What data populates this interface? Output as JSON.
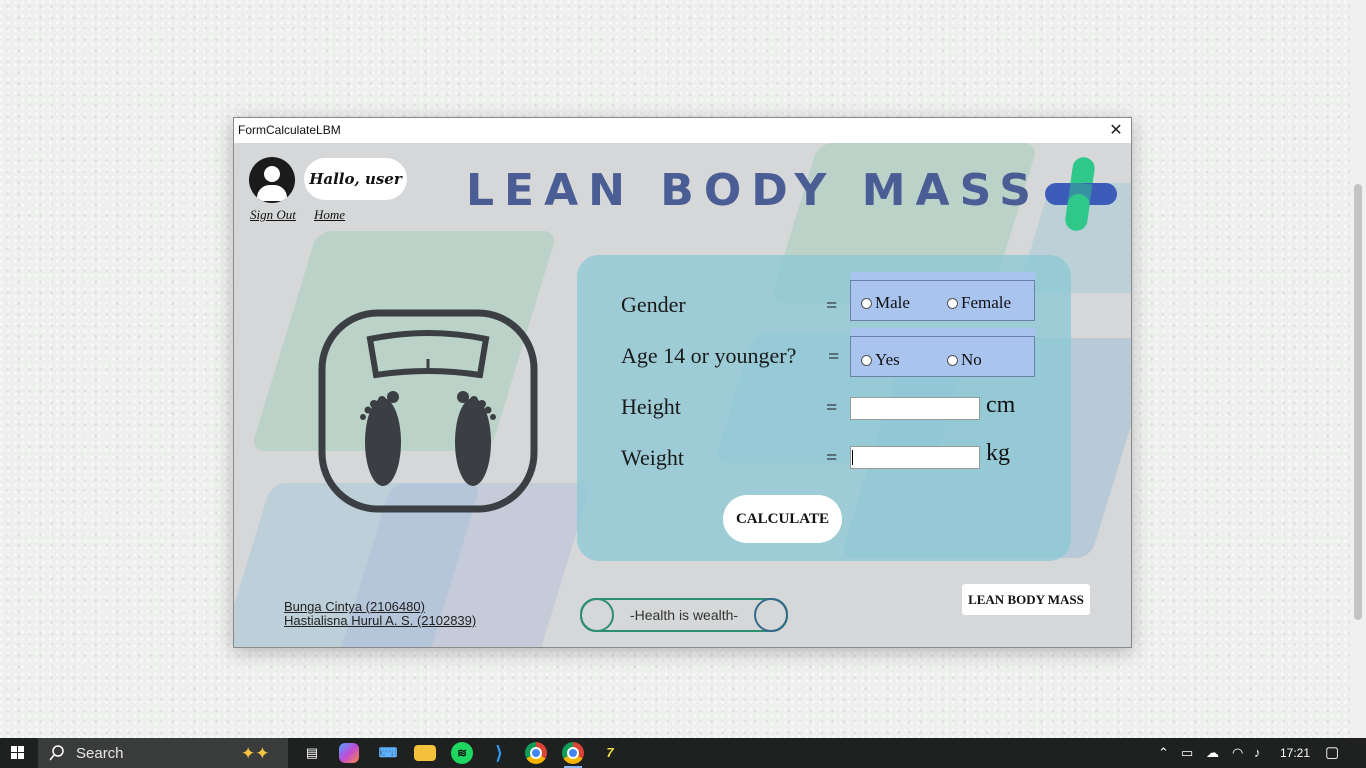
{
  "window": {
    "title": "FormCalculateLBM",
    "close_glyph": "✕"
  },
  "header": {
    "greeting": "Hallo, user",
    "sign_out": "Sign Out",
    "home": "Home",
    "title": "LEAN BODY MASS"
  },
  "form": {
    "gender_label": "Gender",
    "gender_options": [
      "Male",
      "Female"
    ],
    "age_label": "Age 14 or younger?",
    "age_options": [
      "Yes",
      "No"
    ],
    "height_label": "Height",
    "height_value": "",
    "height_unit": "cm",
    "weight_label": "Weight",
    "weight_value": "",
    "weight_unit": "kg",
    "equals": "=",
    "calculate": "CALCULATE"
  },
  "footer": {
    "credit_1": "Bunga Cintya (2106480)",
    "credit_2": "Hastialisna Hurul A. S. (2102839)",
    "motto": "-Health is wealth-",
    "lbm_button": "LEAN BODY MASS"
  },
  "taskbar": {
    "search_placeholder": "Search",
    "time": "17:21",
    "apps": [
      "task-view-icon",
      "copilot-icon",
      "keyboard-icon",
      "file-explorer-icon",
      "spotify-icon",
      "vscode-icon",
      "chrome-icon",
      "chrome-icon-2",
      "editor-icon"
    ]
  },
  "colors": {
    "title": "#4a5d94",
    "logo_green": "#2fc78a",
    "logo_blue": "#3d5bb8",
    "panel": "#8ac8d5",
    "radio_box": "#a9c4ef"
  }
}
